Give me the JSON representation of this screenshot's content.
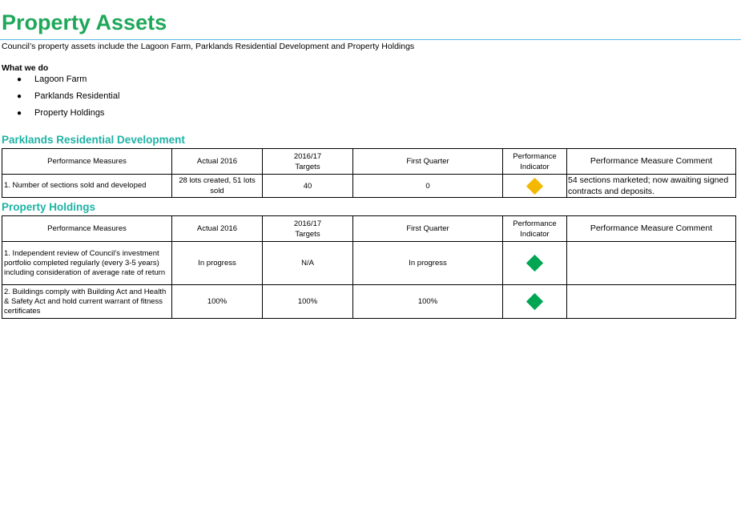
{
  "title": "Property Assets",
  "intro": "Council’s property assets include the Lagoon Farm, Parklands Residential Development and Property Holdings",
  "what_we_do": {
    "heading": "What we do",
    "items": [
      "Lagoon Farm",
      "Parklands Residential",
      "Property Holdings"
    ]
  },
  "colors": {
    "title": "#1fa85a",
    "section_heading": "#1eb3a6",
    "indicator_amber": "#f5b800",
    "indicator_green": "#00a651"
  },
  "headers": {
    "measures": "Performance Measures",
    "actual": "Actual 2016",
    "targets_line1": "2016/17",
    "targets_line2": "Targets",
    "quarter": "First Quarter",
    "indicator_line1": "Performance",
    "indicator_line2": "Indicator",
    "comment": "Performance Measure Comment"
  },
  "sections": [
    {
      "heading": "Parklands Residential Development",
      "rows": [
        {
          "measure": "1.  Number of sections sold and developed",
          "actual": "28 lots created, 51 lots sold",
          "target": "40",
          "quarter": "0",
          "indicator": "amber",
          "comment": "54 sections marketed; now awaiting signed contracts and deposits."
        }
      ]
    },
    {
      "heading": "Property Holdings",
      "rows": [
        {
          "measure": "1.  Independent review of Council’s investment portfolio completed regularly (every 3-5 years) including consideration of average rate of return",
          "actual": "In progress",
          "target": "N/A",
          "quarter": "In progress",
          "indicator": "green",
          "comment": ""
        },
        {
          "measure": "2.  Buildings comply with Building Act and Health & Safety Act and hold current warrant of fitness certificates",
          "actual": "100%",
          "target": "100%",
          "quarter": "100%",
          "indicator": "green",
          "comment": ""
        }
      ]
    }
  ]
}
